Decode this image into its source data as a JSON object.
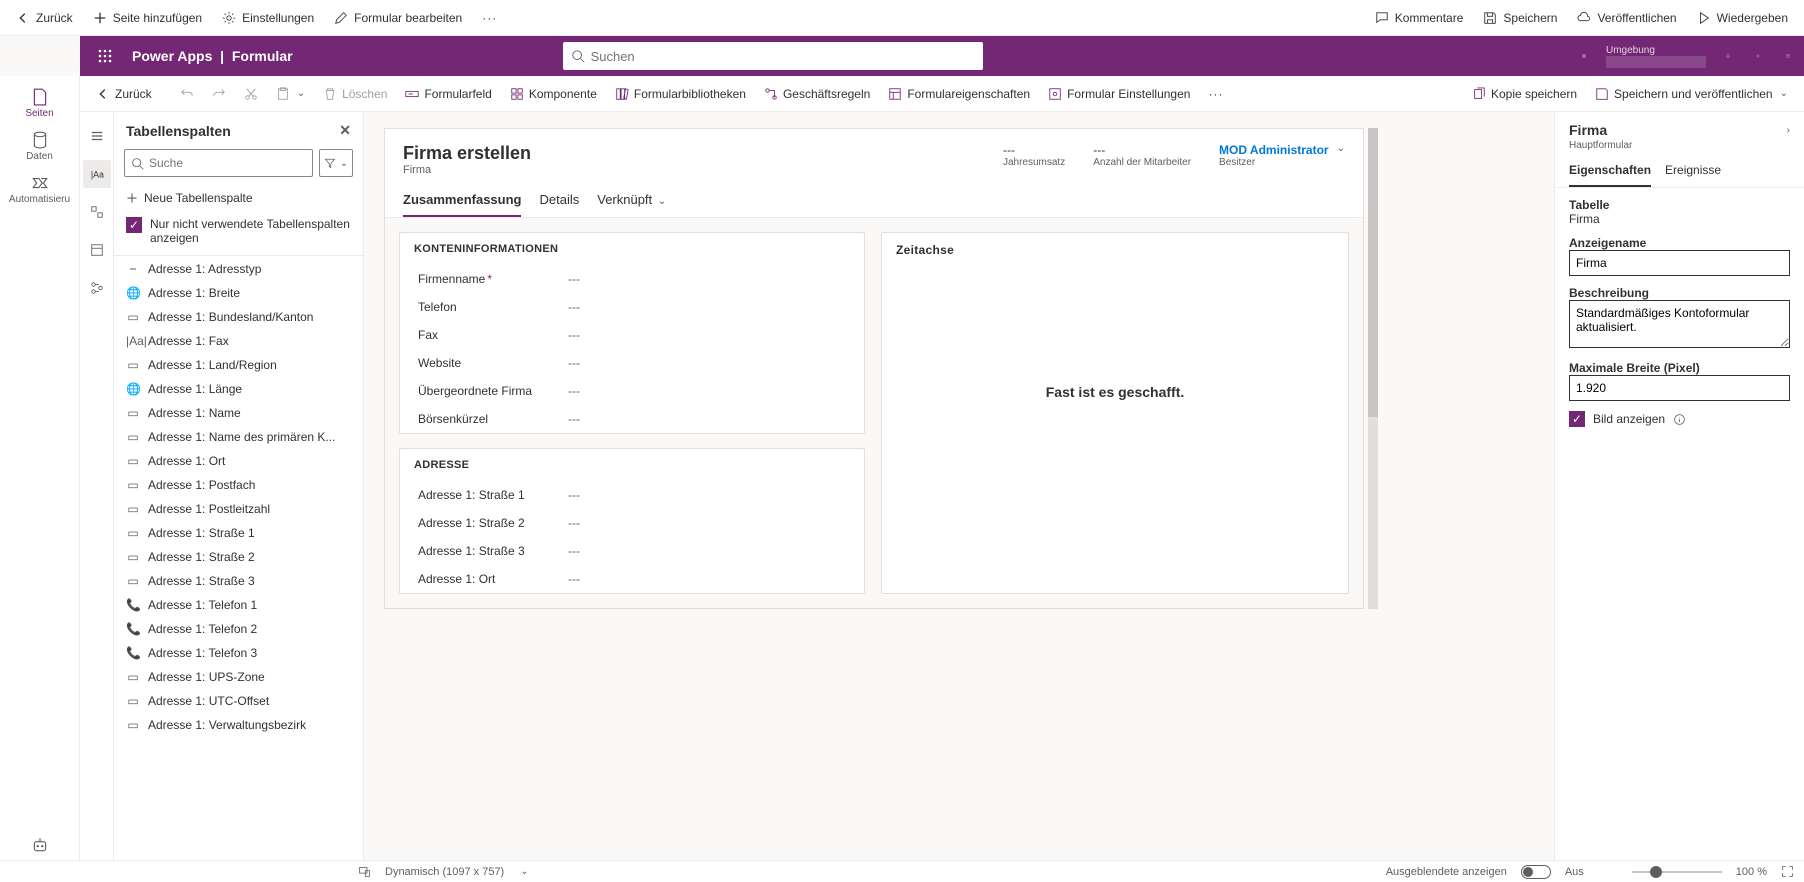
{
  "topbar": {
    "back": "Zurück",
    "addPage": "Seite hinzufügen",
    "settings": "Einstellungen",
    "editForm": "Formular bearbeiten",
    "comments": "Kommentare",
    "save": "Speichern",
    "publish": "Veröffentlichen",
    "play": "Wiedergeben"
  },
  "purple": {
    "app": "Power Apps",
    "sep": "|",
    "context": "Formular",
    "searchPlaceholder": "Suchen",
    "envLabel": "Umgebung",
    "envValue": ""
  },
  "cmd": {
    "back": "Zurück",
    "delete": "Löschen",
    "formField": "Formularfeld",
    "component": "Komponente",
    "formLibs": "Formularbibliotheken",
    "bizRules": "Geschäftsregeln",
    "formProps": "Formulareigenschaften",
    "formSettings": "Formular Einstellungen",
    "saveCopy": "Kopie speichern",
    "savePublish": "Speichern und veröffentlichen"
  },
  "rail": {
    "pages": "Seiten",
    "data": "Daten",
    "automate": "Automatisieru"
  },
  "colPanel": {
    "title": "Tabellenspalten",
    "searchPlaceholder": "Suche",
    "newCol": "Neue Tabellenspalte",
    "onlyUnused": "Nur nicht verwendete Tabellenspalten anzeigen",
    "items": [
      "Adresse 1: Adresstyp",
      "Adresse 1: Breite",
      "Adresse 1: Bundesland/Kanton",
      "Adresse 1: Fax",
      "Adresse 1: Land/Region",
      "Adresse 1: Länge",
      "Adresse 1: Name",
      "Adresse 1: Name des primären K...",
      "Adresse 1: Ort",
      "Adresse 1: Postfach",
      "Adresse 1: Postleitzahl",
      "Adresse 1: Straße 1",
      "Adresse 1: Straße 2",
      "Adresse 1: Straße 3",
      "Adresse 1: Telefon 1",
      "Adresse 1: Telefon 2",
      "Adresse 1: Telefon 3",
      "Adresse 1: UPS-Zone",
      "Adresse 1: UTC-Offset",
      "Adresse 1: Verwaltungsbezirk"
    ]
  },
  "form": {
    "title": "Firma erstellen",
    "subtitle": "Firma",
    "meta": {
      "rev": {
        "v": "---",
        "l": "Jahresumsatz"
      },
      "emp": {
        "v": "---",
        "l": "Anzahl der Mitarbeiter"
      },
      "owner": {
        "v": "MOD Administrator",
        "l": "Besitzer"
      }
    },
    "tabs": {
      "t1": "Zusammenfassung",
      "t2": "Details",
      "t3": "Verknüpft"
    },
    "section1": "KONTENINFORMATIONEN",
    "fields1": [
      {
        "l": "Firmenname",
        "req": true,
        "v": "---"
      },
      {
        "l": "Telefon",
        "req": false,
        "v": "---"
      },
      {
        "l": "Fax",
        "req": false,
        "v": "---"
      },
      {
        "l": "Website",
        "req": false,
        "v": "---"
      },
      {
        "l": "Übergeordnete Firma",
        "req": false,
        "v": "---"
      },
      {
        "l": "Börsenkürzel",
        "req": false,
        "v": "---"
      }
    ],
    "section2": "ADRESSE",
    "fields2": [
      {
        "l": "Adresse 1: Straße 1",
        "v": "---"
      },
      {
        "l": "Adresse 1: Straße 2",
        "v": "---"
      },
      {
        "l": "Adresse 1: Straße 3",
        "v": "---"
      },
      {
        "l": "Adresse 1: Ort",
        "v": "---"
      }
    ],
    "timelineTitle": "Zeitachse",
    "timelineMsg": "Fast ist es geschafft."
  },
  "props": {
    "title": "Firma",
    "sub": "Hauptformular",
    "tab1": "Eigenschaften",
    "tab2": "Ereignisse",
    "tableLbl": "Tabelle",
    "tableVal": "Firma",
    "dispLbl": "Anzeigename",
    "dispVal": "Firma",
    "descLbl": "Beschreibung",
    "descVal": "Standardmäßiges Kontoformular aktualisiert.",
    "maxWLbl": "Maximale Breite (Pixel)",
    "maxWVal": "1.920",
    "showImg": "Bild anzeigen"
  },
  "status": {
    "dim": "Dynamisch (1097 x 757)",
    "hidden": "Ausgeblendete anzeigen",
    "toggle": "Aus",
    "zoom": "100 %"
  }
}
